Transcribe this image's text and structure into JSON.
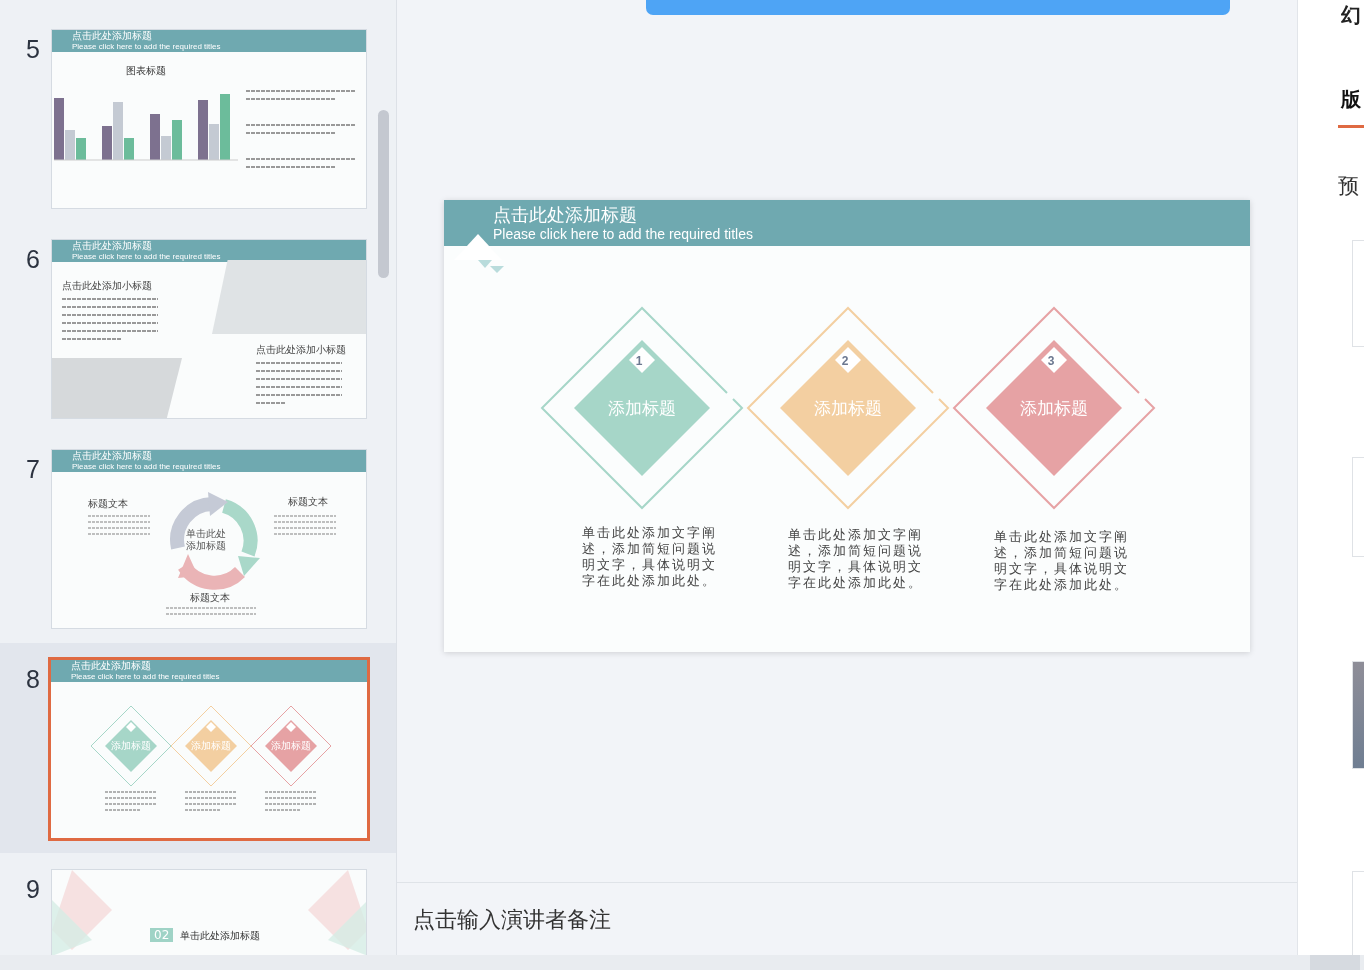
{
  "thumbnails": [
    {
      "number": "5",
      "selected": false,
      "kind": "chart",
      "title": "点击此处添加标题",
      "subtitle": "Please click here to add the required titles",
      "chart_title": "图表标题"
    },
    {
      "number": "6",
      "selected": false,
      "kind": "photos",
      "title": "点击此处添加标题",
      "subtitle": "Please click here to add the required titles",
      "headings": [
        "点击此处添加小标题",
        "点击此处添加小标题"
      ]
    },
    {
      "number": "7",
      "selected": false,
      "kind": "cycle",
      "title": "点击此处添加标题",
      "subtitle": "Please click here to add the required titles",
      "center": "单击此处添加标题",
      "labels": [
        "标题文本",
        "标题文本",
        "标题文本"
      ]
    },
    {
      "number": "8",
      "selected": true,
      "kind": "diamonds",
      "title": "点击此处添加标题",
      "subtitle": "Please click here to add the required titles",
      "labels": [
        "添加标题",
        "添加标题",
        "添加标题"
      ]
    },
    {
      "number": "9",
      "selected": false,
      "kind": "section",
      "badge": "02",
      "heading": "单击此处添加标题"
    }
  ],
  "slide": {
    "title": "点击此处添加标题",
    "subtitle": "Please click here to add the required titles",
    "items": [
      {
        "number": "1",
        "label": "添加标题",
        "color": "#a6d6c8",
        "text": "单击此处添加文字阐述，添加简短问题说明文字，具体说明文字在此处添加此处。"
      },
      {
        "number": "2",
        "label": "添加标题",
        "color": "#f3cfa1",
        "text": "单击此处添加文字阐述，添加简短问题说明文字，具体说明文字在此处添加此处。"
      },
      {
        "number": "3",
        "label": "添加标题",
        "color": "#e6a2a4",
        "text": "单击此处添加文字阐述，添加简短问题说明文字，具体说明文字在此处添加此处。"
      }
    ]
  },
  "notes": {
    "placeholder": "点击输入演讲者备注"
  },
  "right_panel": {
    "title": "幻",
    "tabs": [
      {
        "label": "版",
        "selected": true
      }
    ],
    "section": "预"
  }
}
